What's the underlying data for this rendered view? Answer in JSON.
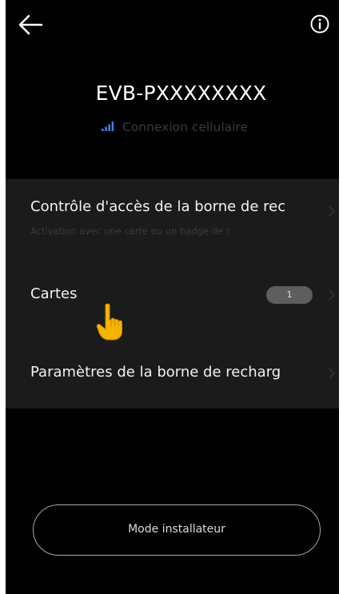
{
  "header": {
    "back_icon": "arrow-left-icon",
    "info_icon": "info-circle-icon"
  },
  "device": {
    "name": "EVB-PXXXXXXXX",
    "connection_label": "Connexion cellulaire",
    "connection_icon": "signal-bars-icon"
  },
  "settings": {
    "items": [
      {
        "title": "Contrôle d'accès de la borne de rec",
        "subtitle": "Activation avec une carte ou un badge de r"
      },
      {
        "title": "Cartes",
        "badge": "1"
      },
      {
        "title": "Paramètres de la borne de recharg"
      }
    ]
  },
  "footer": {
    "installer_mode_label": "Mode installateur"
  },
  "colors": {
    "background": "#000000",
    "panel": "#1b1b1b",
    "accent_signal": "#3d7de0",
    "badge": "#5e5e5e",
    "pointer_hand": "#f4b400"
  }
}
